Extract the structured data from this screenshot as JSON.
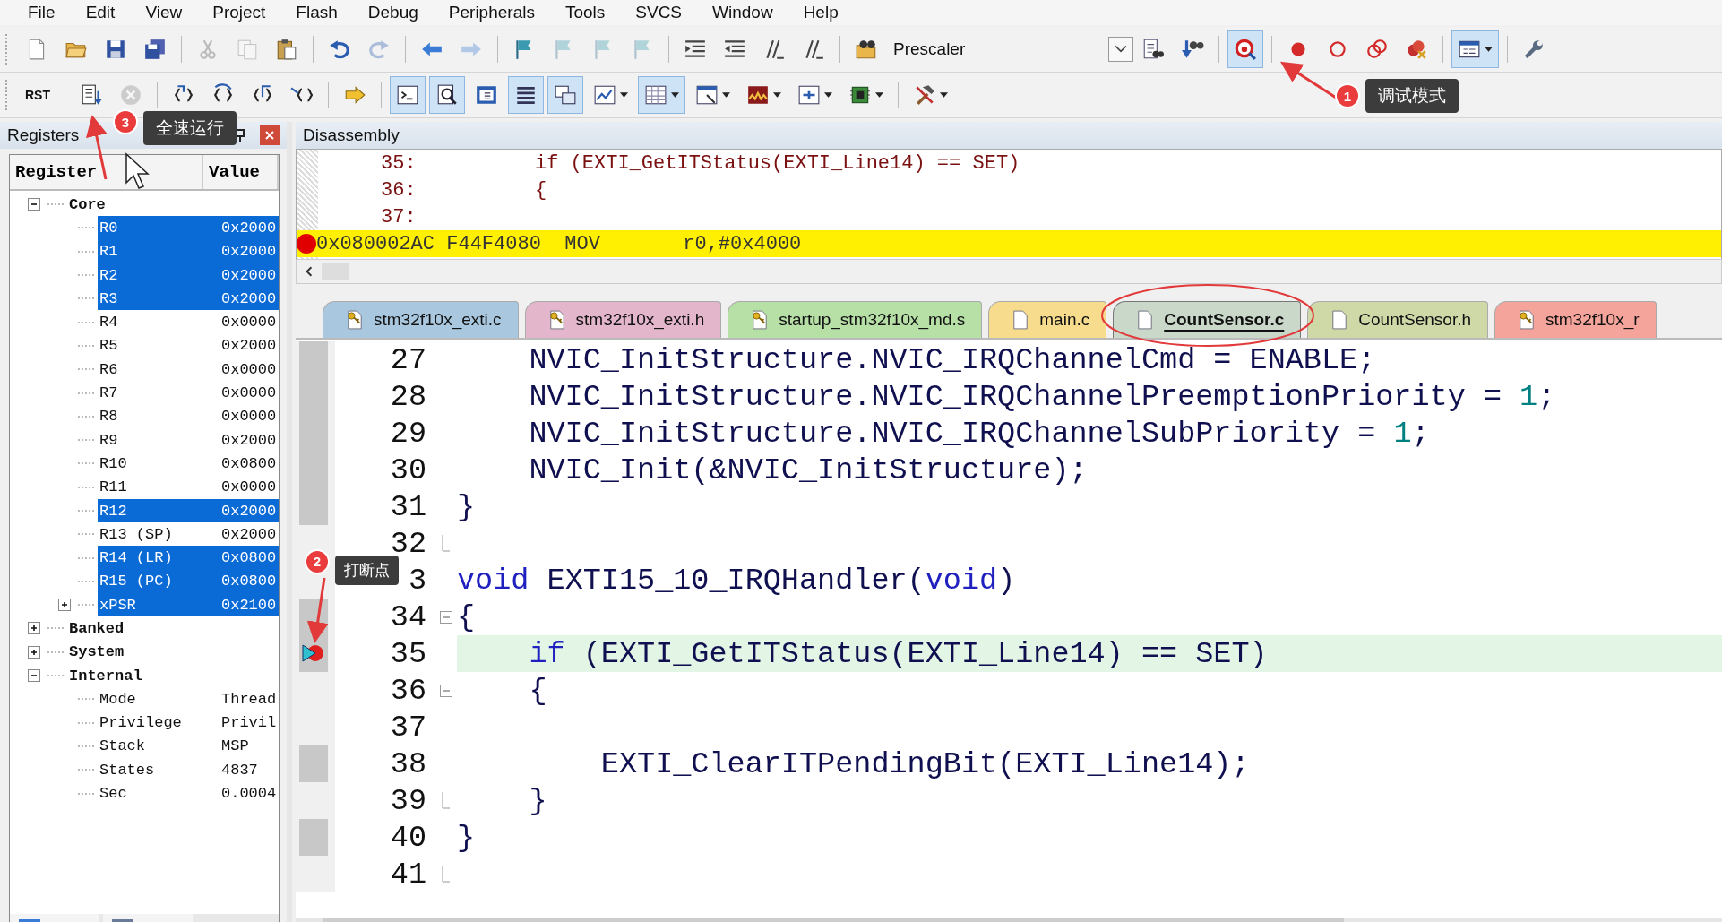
{
  "menu": [
    {
      "label": "File"
    },
    {
      "label": "Edit"
    },
    {
      "label": "View"
    },
    {
      "label": "Project"
    },
    {
      "label": "Flash"
    },
    {
      "label": "Debug"
    },
    {
      "label": "Peripherals"
    },
    {
      "label": "Tools"
    },
    {
      "label": "SVCS"
    },
    {
      "label": "Window"
    },
    {
      "label": "Help"
    }
  ],
  "toolbar_1": [
    {
      "kind": "new",
      "disabled": false,
      "pressed": false
    },
    {
      "kind": "open",
      "disabled": false,
      "pressed": false
    },
    {
      "kind": "save",
      "disabled": false,
      "pressed": false
    },
    {
      "kind": "saveall",
      "disabled": false,
      "pressed": false
    },
    {
      "kind": "separator"
    },
    {
      "kind": "cut",
      "disabled": true,
      "pressed": false
    },
    {
      "kind": "copy",
      "disabled": true,
      "pressed": false
    },
    {
      "kind": "paste",
      "disabled": false,
      "pressed": false
    },
    {
      "kind": "separator"
    },
    {
      "kind": "undo",
      "disabled": false,
      "pressed": false
    },
    {
      "kind": "redo",
      "disabled": true,
      "pressed": false
    },
    {
      "kind": "separator"
    },
    {
      "kind": "back",
      "disabled": false,
      "pressed": false
    },
    {
      "kind": "forward",
      "disabled": true,
      "pressed": false
    },
    {
      "kind": "separator"
    },
    {
      "kind": "bookmark",
      "disabled": false,
      "pressed": false
    },
    {
      "kind": "bookmark",
      "disabled": true,
      "pressed": false
    },
    {
      "kind": "bookmark",
      "disabled": true,
      "pressed": false
    },
    {
      "kind": "bookmark",
      "disabled": true,
      "pressed": false
    },
    {
      "kind": "separator"
    },
    {
      "kind": "indent",
      "disabled": false,
      "pressed": false
    },
    {
      "kind": "outdent",
      "disabled": false,
      "pressed": false
    },
    {
      "kind": "comment",
      "disabled": false,
      "pressed": false
    },
    {
      "kind": "comment",
      "disabled": false,
      "pressed": false
    },
    {
      "kind": "separator"
    },
    {
      "kind": "findfiles",
      "disabled": false,
      "pressed": false
    },
    {
      "kind": "combo",
      "value": "Prescaler"
    },
    {
      "kind": "find",
      "disabled": false,
      "pressed": false
    },
    {
      "kind": "incfind",
      "disabled": false,
      "pressed": false
    },
    {
      "kind": "separator"
    },
    {
      "kind": "debug",
      "disabled": false,
      "pressed": true
    },
    {
      "kind": "separator"
    },
    {
      "kind": "bp",
      "disabled": false,
      "pressed": false
    },
    {
      "kind": "bpring",
      "disabled": false,
      "pressed": false
    },
    {
      "kind": "bprings",
      "disabled": false,
      "pressed": false
    },
    {
      "kind": "bpkill",
      "disabled": false,
      "pressed": false
    },
    {
      "kind": "separator"
    },
    {
      "kind": "window",
      "disabled": false,
      "pressed": true,
      "dropdown": true
    },
    {
      "kind": "separator"
    },
    {
      "kind": "wrench",
      "disabled": false,
      "pressed": false
    }
  ],
  "toolbar_2": [
    {
      "kind": "rst",
      "label": "RST",
      "disabled": false,
      "pressed": false
    },
    {
      "kind": "separator"
    },
    {
      "kind": "run",
      "disabled": false,
      "pressed": false
    },
    {
      "kind": "stop",
      "disabled": true,
      "pressed": false
    },
    {
      "kind": "separator"
    },
    {
      "kind": "stepinto",
      "disabled": false,
      "pressed": false
    },
    {
      "kind": "stepover",
      "disabled": false,
      "pressed": false
    },
    {
      "kind": "stepout",
      "disabled": false,
      "pressed": false
    },
    {
      "kind": "runto",
      "disabled": false,
      "pressed": false
    },
    {
      "kind": "separator"
    },
    {
      "kind": "shownext",
      "disabled": false,
      "pressed": false
    },
    {
      "kind": "separator"
    },
    {
      "kind": "command",
      "disabled": false,
      "pressed": true
    },
    {
      "kind": "disasm",
      "disabled": false,
      "pressed": true
    },
    {
      "kind": "symbols",
      "disabled": false,
      "pressed": false
    },
    {
      "kind": "registers",
      "disabled": false,
      "pressed": true
    },
    {
      "kind": "callstack",
      "disabled": false,
      "pressed": true
    },
    {
      "kind": "watch",
      "disabled": false,
      "pressed": false,
      "dropdown": true
    },
    {
      "kind": "memory",
      "disabled": false,
      "pressed": true,
      "dropdown": true
    },
    {
      "kind": "serial",
      "disabled": false,
      "pressed": false,
      "dropdown": true
    },
    {
      "kind": "analysis",
      "disabled": false,
      "pressed": false,
      "dropdown": true
    },
    {
      "kind": "trace",
      "disabled": false,
      "pressed": false,
      "dropdown": true
    },
    {
      "kind": "sysview",
      "disabled": false,
      "pressed": false,
      "dropdown": true
    },
    {
      "kind": "separator"
    },
    {
      "kind": "toolbox",
      "disabled": false,
      "pressed": false,
      "dropdown": true
    }
  ],
  "registers": {
    "title": "Registers",
    "columns": [
      "Register",
      "Value"
    ],
    "tree": [
      {
        "name": "Core",
        "expanded": true,
        "selected": false,
        "children": [
          {
            "name": "R0",
            "value": "0x2000",
            "selected": true
          },
          {
            "name": "R1",
            "value": "0x2000",
            "selected": true
          },
          {
            "name": "R2",
            "value": "0x2000",
            "selected": true
          },
          {
            "name": "R3",
            "value": "0x2000",
            "selected": true
          },
          {
            "name": "R4",
            "value": "0x0000",
            "selected": false
          },
          {
            "name": "R5",
            "value": "0x2000",
            "selected": false
          },
          {
            "name": "R6",
            "value": "0x0000",
            "selected": false
          },
          {
            "name": "R7",
            "value": "0x0000",
            "selected": false
          },
          {
            "name": "R8",
            "value": "0x0000",
            "selected": false
          },
          {
            "name": "R9",
            "value": "0x2000",
            "selected": false
          },
          {
            "name": "R10",
            "value": "0x0800",
            "selected": false
          },
          {
            "name": "R11",
            "value": "0x0000",
            "selected": false
          },
          {
            "name": "R12",
            "value": "0x2000",
            "selected": true
          },
          {
            "name": "R13 (SP)",
            "value": "0x2000",
            "selected": false
          },
          {
            "name": "R14 (LR)",
            "value": "0x0800",
            "selected": true
          },
          {
            "name": "R15 (PC)",
            "value": "0x0800",
            "selected": true
          },
          {
            "name": "xPSR",
            "value": "0x2100",
            "selected": true,
            "expanded": false
          }
        ]
      },
      {
        "name": "Banked",
        "expanded": false,
        "selected": false
      },
      {
        "name": "System",
        "expanded": false,
        "selected": false
      },
      {
        "name": "Internal",
        "expanded": true,
        "selected": false,
        "children": [
          {
            "name": "Mode",
            "value": "Thread",
            "selected": false
          },
          {
            "name": "Privilege",
            "value": "Privil",
            "selected": false
          },
          {
            "name": "Stack",
            "value": "MSP",
            "selected": false
          },
          {
            "name": "States",
            "value": "4837",
            "selected": false
          },
          {
            "name": "Sec",
            "value": "0.0004",
            "selected": false
          }
        ]
      }
    ]
  },
  "disassembly": {
    "title": "Disassembly",
    "lines": [
      {
        "kind": "source",
        "number": "35:",
        "code": "if (EXTI_GetITStatus(EXTI_Line14) == SET)"
      },
      {
        "kind": "source",
        "number": "36:",
        "code": "{"
      },
      {
        "kind": "source",
        "number": "37:"
      },
      {
        "kind": "instruction",
        "text": "0x080002AC F44F4080  MOV       r0,#0x4000",
        "current": true,
        "breakpoint": true
      }
    ]
  },
  "tabs": [
    {
      "label": "stm32f10x_exti.c",
      "color": "#a9c8e0",
      "read_only": true,
      "selected": false
    },
    {
      "label": "stm32f10x_exti.h",
      "color": "#e3b6cb",
      "read_only": true,
      "selected": false
    },
    {
      "label": "startup_stm32f10x_md.s",
      "color": "#b7e0a6",
      "read_only": true,
      "selected": false
    },
    {
      "label": "main.c",
      "color": "#f6dc8c",
      "read_only": false,
      "selected": false
    },
    {
      "label": "CountSensor.c",
      "color": "#c9d8c9",
      "read_only": false,
      "selected": true
    },
    {
      "label": "CountSensor.h",
      "color": "#cfd9a8",
      "read_only": false,
      "selected": false
    },
    {
      "label": "stm32f10x_r",
      "color": "#f4a49a",
      "read_only": true,
      "selected": false
    }
  ],
  "editor": {
    "lines": [
      {
        "number": "27",
        "executable": true,
        "segments": [
          {
            "kind": "plain",
            "text": "    NVIC_InitStructure.NVIC_IRQChannelCmd = ENABLE;"
          }
        ]
      },
      {
        "number": "28",
        "executable": true,
        "segments": [
          {
            "kind": "plain",
            "text": "    NVIC_InitStructure.NVIC_IRQChannelPreemptionPriority = "
          },
          {
            "kind": "number",
            "text": "1"
          },
          {
            "kind": "plain",
            "text": ";"
          }
        ]
      },
      {
        "number": "29",
        "executable": true,
        "segments": [
          {
            "kind": "plain",
            "text": "    NVIC_InitStructure.NVIC_IRQChannelSubPriority = "
          },
          {
            "kind": "number",
            "text": "1"
          },
          {
            "kind": "plain",
            "text": ";"
          }
        ]
      },
      {
        "number": "30",
        "executable": true,
        "segments": [
          {
            "kind": "plain",
            "text": "    NVIC_Init(&NVIC_InitStructure);"
          }
        ]
      },
      {
        "number": "31",
        "executable": true,
        "segments": [
          {
            "kind": "plain",
            "text": "}"
          }
        ]
      },
      {
        "number": "32",
        "executable": false,
        "fold_end": true
      },
      {
        "number": "3",
        "executable": false,
        "segments": [
          {
            "kind": "keyword",
            "text": "void"
          },
          {
            "kind": "plain",
            "text": " EXTI15_10_IRQHandler("
          },
          {
            "kind": "keyword",
            "text": "void"
          },
          {
            "kind": "plain",
            "text": ")"
          }
        ]
      },
      {
        "number": "34",
        "executable": true,
        "fold_start": true,
        "segments": [
          {
            "kind": "plain",
            "text": "{"
          }
        ]
      },
      {
        "number": "35",
        "executable": true,
        "current": true,
        "breakpoint": true,
        "segments": [
          {
            "kind": "keyword",
            "text": "    if"
          },
          {
            "kind": "plain",
            "text": " (EXTI_GetITStatus(EXTI_Line14) == SET)"
          }
        ]
      },
      {
        "number": "36",
        "executable": false,
        "fold_start": true,
        "segments": [
          {
            "kind": "plain",
            "text": "    {"
          }
        ]
      },
      {
        "number": "37",
        "executable": false
      },
      {
        "number": "38",
        "executable": true,
        "segments": [
          {
            "kind": "plain",
            "text": "        EXTI_ClearITPendingBit(EXTI_Line14);"
          }
        ]
      },
      {
        "number": "39",
        "executable": false,
        "fold_end": true,
        "segments": [
          {
            "kind": "plain",
            "text": "    }"
          }
        ]
      },
      {
        "number": "40",
        "executable": true,
        "segments": [
          {
            "kind": "plain",
            "text": "}"
          }
        ]
      },
      {
        "number": "41",
        "executable": false,
        "fold_end": true
      }
    ]
  },
  "annotations": [
    {
      "number": "1",
      "label": "调试模式"
    },
    {
      "number": "3",
      "label": "全速运行"
    },
    {
      "number": "2",
      "label": "打断点"
    }
  ]
}
